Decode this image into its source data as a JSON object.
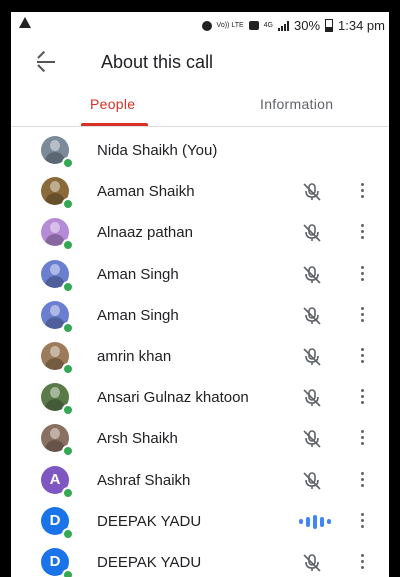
{
  "status_bar": {
    "icons": [
      "warning-icon",
      "alarm-icon",
      "volte-icon",
      "cast-icon",
      "network-icon",
      "signal-icon",
      "battery-icon"
    ],
    "volte_label": "Vo)) LTE",
    "network_label": "4G",
    "battery_percent": "30%",
    "time": "1:34 pm"
  },
  "header": {
    "title": "About this call"
  },
  "tabs": [
    {
      "label": "People",
      "selected": true
    },
    {
      "label": "Information",
      "selected": false
    }
  ],
  "participants": [
    {
      "name": "Nida Shaikh (You)",
      "avatar": "photo",
      "avatar_color": "#7a8a99",
      "muted": null,
      "menu": false
    },
    {
      "name": "Aaman Shaikh",
      "avatar": "photo",
      "avatar_color": "#8a6a3a",
      "muted": true,
      "menu": true
    },
    {
      "name": "Alnaaz pathan",
      "avatar": "photo",
      "avatar_color": "#b58ad6",
      "muted": true,
      "menu": true
    },
    {
      "name": "Aman Singh",
      "avatar": "photo",
      "avatar_color": "#6a7fd0",
      "muted": true,
      "menu": true
    },
    {
      "name": "Aman Singh",
      "avatar": "photo",
      "avatar_color": "#6a7fd0",
      "muted": true,
      "menu": true
    },
    {
      "name": "amrin khan",
      "avatar": "photo",
      "avatar_color": "#9b7b5a",
      "muted": true,
      "menu": true
    },
    {
      "name": "Ansari Gulnaz khatoon",
      "avatar": "photo",
      "avatar_color": "#5b7a4a",
      "muted": true,
      "menu": true
    },
    {
      "name": "Arsh Shaikh",
      "avatar": "photo",
      "avatar_color": "#8a7060",
      "muted": true,
      "menu": true
    },
    {
      "name": "Ashraf Shaikh",
      "avatar": "letter",
      "letter": "A",
      "avatar_color": "#7e57c2",
      "muted": true,
      "menu": true
    },
    {
      "name": "DEEPAK YADU",
      "avatar": "logo",
      "letter": "D",
      "avatar_color": "#1a73e8",
      "muted": false,
      "speaking": true,
      "menu": true
    },
    {
      "name": "DEEPAK YADU",
      "avatar": "logo",
      "letter": "D",
      "avatar_color": "#1a73e8",
      "muted": true,
      "menu": true
    }
  ],
  "colors": {
    "accent": "#d93025",
    "online_dot": "#34a853",
    "speaking": "#4285f4"
  }
}
